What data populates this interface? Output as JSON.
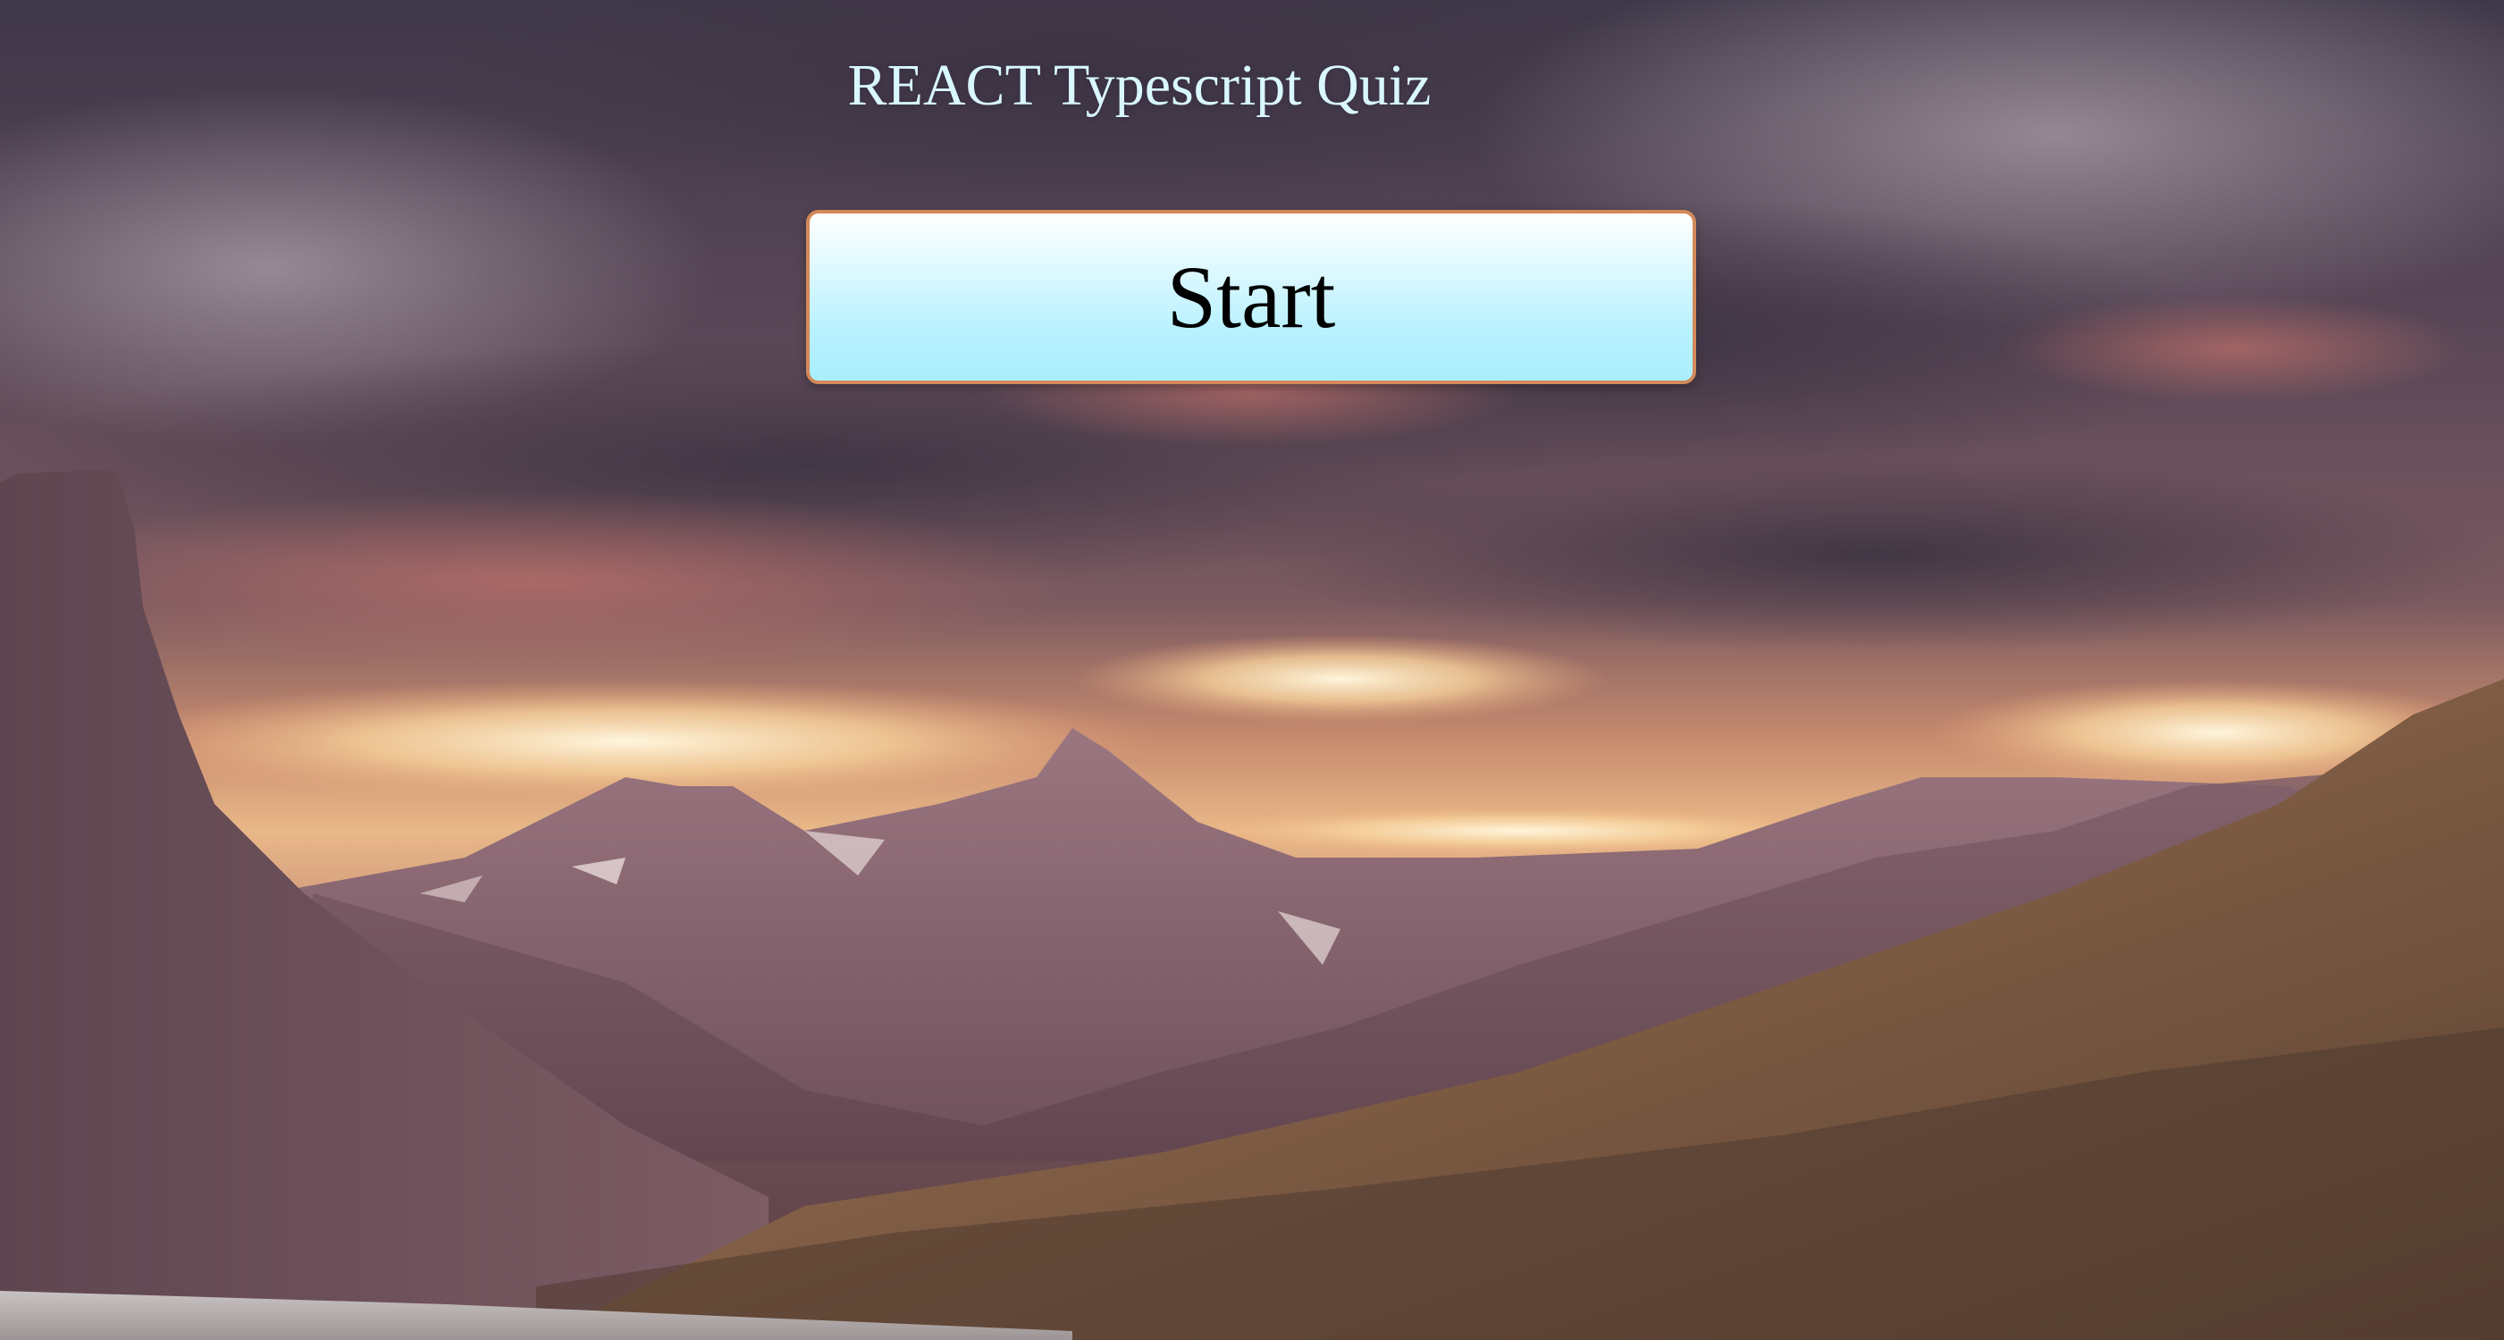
{
  "app": {
    "title": "REACT Typescript Quiz"
  },
  "controls": {
    "start_label": "Start"
  },
  "background": {
    "description_icon": "mountain-sunset-landscape",
    "colors": {
      "sky_top": "#4a3f52",
      "cloud_mauve": "#7a5f6a",
      "sunset_glow": "#f3c58a",
      "sun_highlight": "#fff4d6",
      "mountain_far": "#8e6a72",
      "mountain_near": "#6f5058",
      "hillside": "#7a5a3e",
      "water": "#b8b4b4"
    }
  },
  "theme": {
    "title_color": "#d8f7ff",
    "button_border": "#d38a5a",
    "button_top": "#ffffff",
    "button_bottom": "#a9eefc"
  }
}
